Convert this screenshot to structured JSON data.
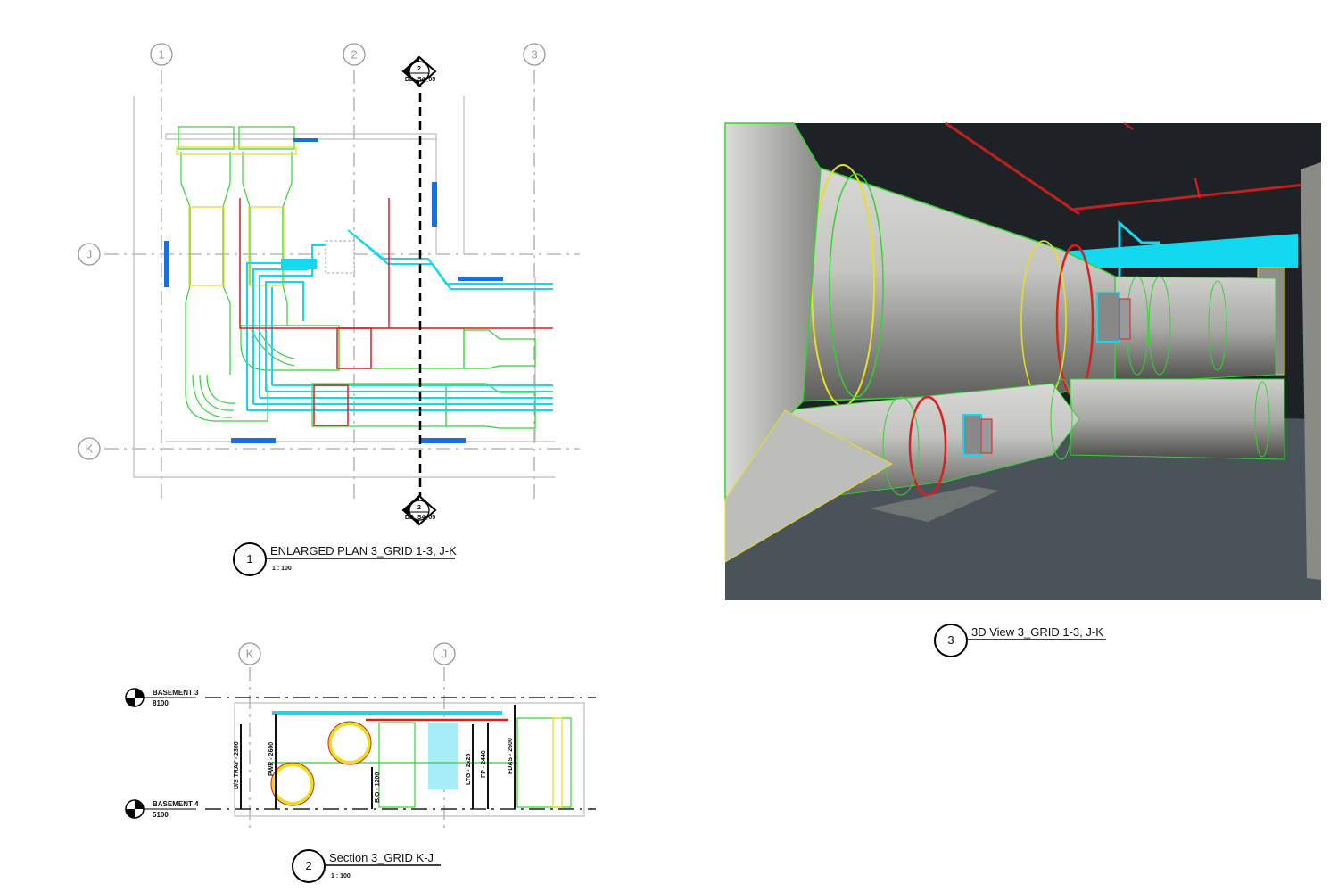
{
  "sheet": {
    "plan": {
      "grid_labels": [
        "1",
        "2",
        "3",
        "J",
        "K"
      ],
      "section_marker": {
        "number": "2",
        "sheet": "DD_S4_05"
      },
      "title_number": "1",
      "title": "ENLARGED PLAN 3_GRID 1-3, J-K",
      "scale": "1 : 100"
    },
    "section": {
      "grid_labels": [
        "K",
        "J"
      ],
      "levels": [
        {
          "name": "BASEMENT 3",
          "elevation": "8100"
        },
        {
          "name": "BASEMENT 4",
          "elevation": "5100"
        }
      ],
      "dimensions": [
        "U/S TRAY - 2300",
        "PWR - 2600",
        "B.O - 1200",
        "LTG - 2x25",
        "FP - 2440",
        "FDAS - 2600"
      ],
      "title_number": "2",
      "title": "Section 3_GRID K-J",
      "scale": "1 : 100"
    },
    "view3d": {
      "title_number": "3",
      "title": "3D View 3_GRID 1-3, J-K"
    }
  },
  "colors": {
    "duct": "#35d235",
    "pipe_cyan": "#12d8f0",
    "fire": "#d92020",
    "accent": "#1a6fe0",
    "yellow": "#e8e020"
  }
}
